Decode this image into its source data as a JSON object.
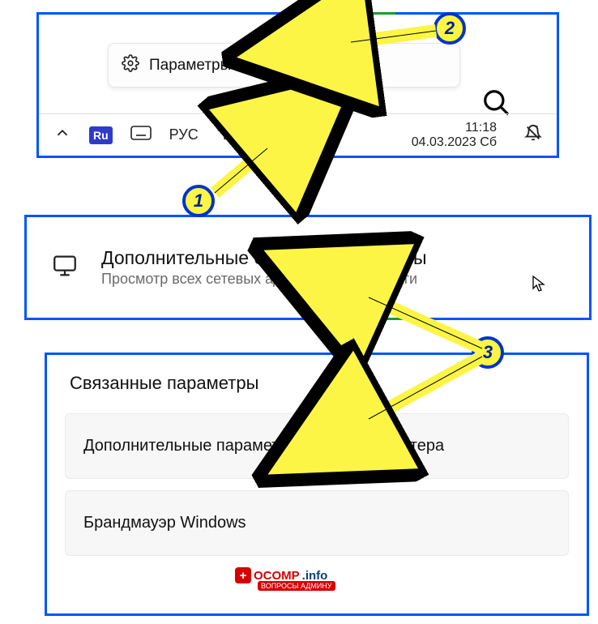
{
  "panel1": {
    "context_item": "Параметры сети и Интернета",
    "taskbar": {
      "lang_badge": "Ru",
      "lang_text": "РУС",
      "time": "11:18",
      "date": "04.03.2023 Сб"
    }
  },
  "panel2": {
    "title": "Дополнительные сетевые параметры",
    "subtitle": "Просмотр всех сетевых адаптеров, сброс сети"
  },
  "panel3": {
    "heading": "Связанные параметры",
    "option1": "Дополнительные параметры сетевого адаптера",
    "option2": "Брандмауэр Windows"
  },
  "badges": {
    "b1": "1",
    "b2": "2",
    "b3": "3"
  },
  "watermark": {
    "brand": "OCOMP",
    "suffix": ".info",
    "tag": "ВОПРОСЫ АДМИНУ"
  }
}
